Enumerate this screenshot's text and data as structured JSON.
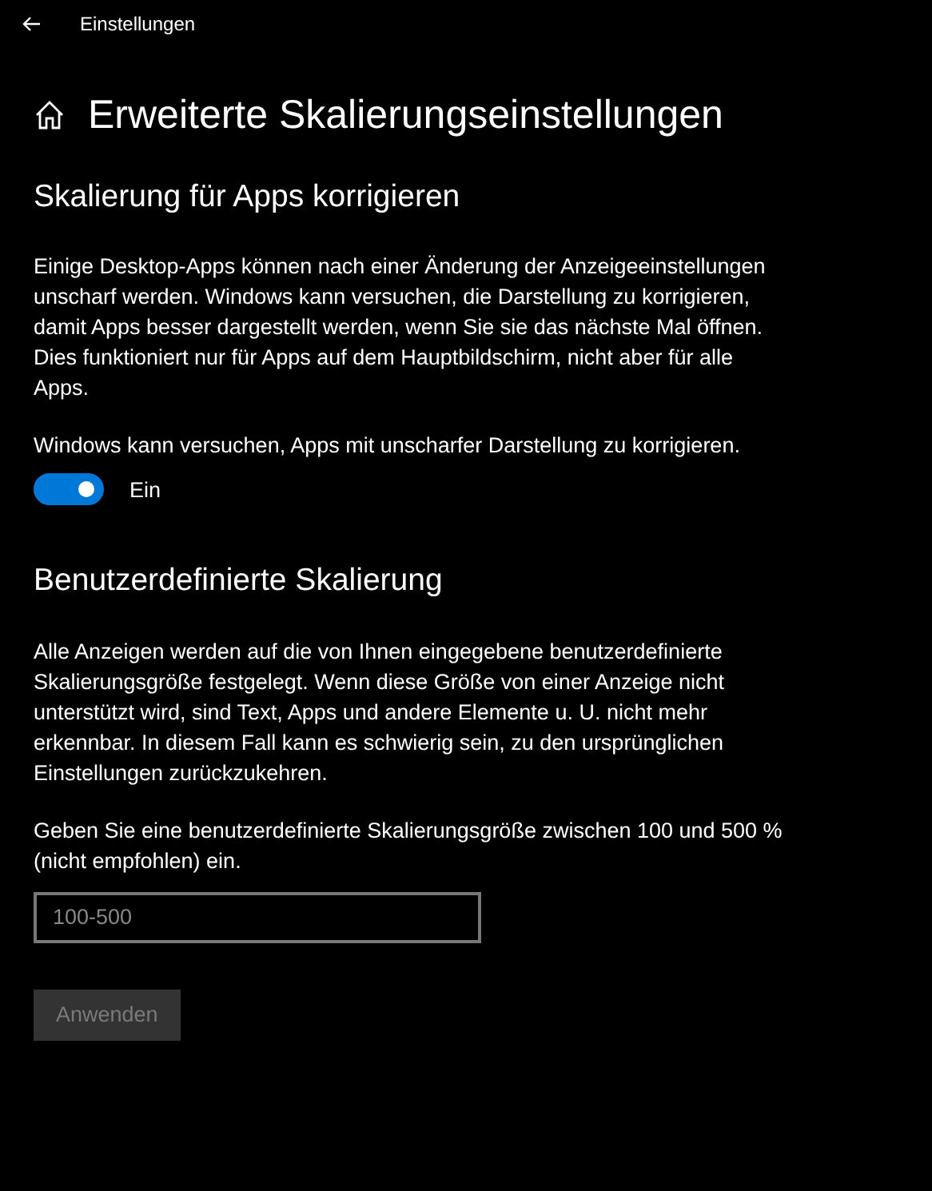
{
  "window": {
    "title": "Einstellungen"
  },
  "page_title": "Erweiterte Skalierungseinstellungen",
  "fix_section": {
    "heading": "Skalierung für Apps korrigieren",
    "description": "Einige Desktop-Apps können nach einer Änderung der Anzeigeeinstellungen unscharf werden. Windows kann versuchen, die Darstellung zu korrigieren, damit Apps besser dargestellt werden, wenn Sie sie das nächste Mal öffnen. Dies funktioniert nur für Apps auf dem Hauptbildschirm, nicht aber für alle Apps.",
    "toggle": {
      "label": "Windows kann versuchen, Apps mit unscharfer Darstellung zu korrigieren.",
      "on": true,
      "state_text": "Ein"
    }
  },
  "custom_section": {
    "heading": "Benutzerdefinierte Skalierung",
    "description": "Alle Anzeigen werden auf die von Ihnen eingegebene benutzerdefinierte Skalierungsgröße festgelegt. Wenn diese Größe von einer Anzeige nicht unterstützt wird, sind Text, Apps und andere Elemente u. U. nicht mehr erkennbar. In diesem Fall kann es schwierig sein, zu den ursprünglichen Einstellungen zurückzukehren.",
    "field_label": "Geben Sie eine benutzerdefinierte Skalierungsgröße zwischen 100 und 500 % (nicht empfohlen) ein.",
    "field": {
      "placeholder": "100-500"
    },
    "button": {
      "label": "Anwenden",
      "disabled": true
    }
  }
}
